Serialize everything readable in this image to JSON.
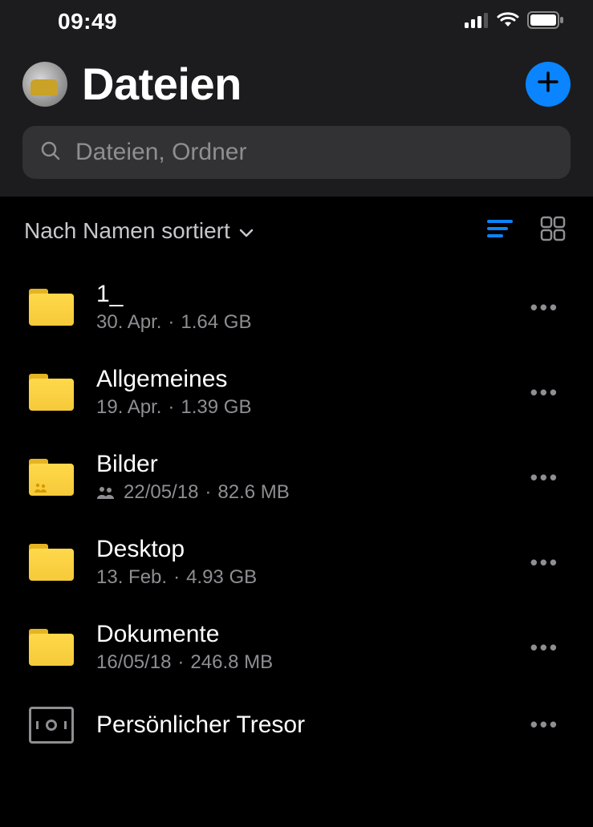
{
  "status": {
    "time": "09:49"
  },
  "header": {
    "title": "Dateien"
  },
  "search": {
    "placeholder": "Dateien, Ordner"
  },
  "sort": {
    "label": "Nach Namen sortiert"
  },
  "files": [
    {
      "name": "1_",
      "date": "30. Apr.",
      "size": "1.64 GB",
      "type": "folder",
      "shared": false
    },
    {
      "name": "Allgemeines",
      "date": "19. Apr.",
      "size": "1.39 GB",
      "type": "folder",
      "shared": false
    },
    {
      "name": "Bilder",
      "date": "22/05/18",
      "size": "82.6 MB",
      "type": "folder",
      "shared": true
    },
    {
      "name": "Desktop",
      "date": "13. Feb.",
      "size": "4.93 GB",
      "type": "folder",
      "shared": false
    },
    {
      "name": "Dokumente",
      "date": "16/05/18",
      "size": "246.8 MB",
      "type": "folder",
      "shared": false
    },
    {
      "name": "Persönlicher Tresor",
      "date": "",
      "size": "",
      "type": "vault",
      "shared": false
    }
  ],
  "colors": {
    "accent": "#0a84ff",
    "folder": "#ffd94a"
  }
}
